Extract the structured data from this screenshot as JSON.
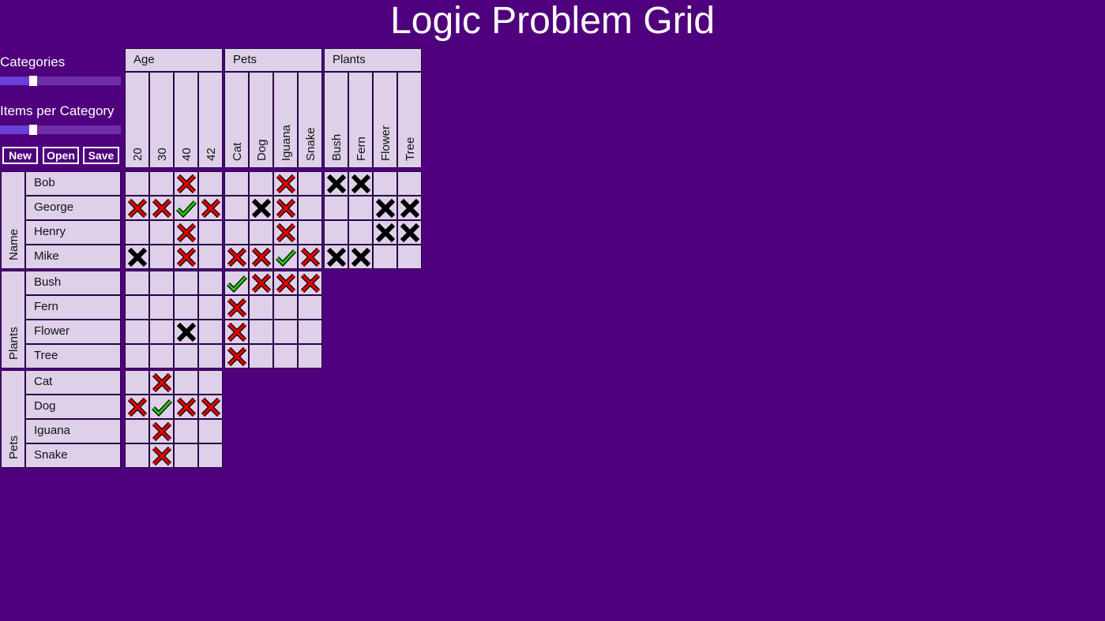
{
  "app": {
    "title": "Logic Problem Grid"
  },
  "controls": {
    "categories_label": "Categories",
    "items_label": "Items per Category",
    "categories_value": 0.27,
    "items_value": 0.27,
    "buttons": {
      "new": "New",
      "open": "Open",
      "save": "Save"
    }
  },
  "colors": {
    "background": "#4f007c",
    "cell": "#ddd0e8",
    "red_x": "#e00000",
    "black_x": "#000000",
    "green_check": "#22cc00"
  },
  "columns": [
    {
      "name": "Age",
      "items": [
        "20",
        "30",
        "40",
        "42"
      ]
    },
    {
      "name": "Pets",
      "items": [
        "Cat",
        "Dog",
        "Iguana",
        "Snake"
      ]
    },
    {
      "name": "Plants",
      "items": [
        "Bush",
        "Fern",
        "Flower",
        "Tree"
      ]
    }
  ],
  "rows": [
    {
      "name": "Name",
      "items": [
        "Bob",
        "George",
        "Henry",
        "Mike"
      ]
    },
    {
      "name": "Plants",
      "items": [
        "Bush",
        "Fern",
        "Flower",
        "Tree"
      ]
    },
    {
      "name": "Pets",
      "items": [
        "Cat",
        "Dog",
        "Iguana",
        "Snake"
      ]
    }
  ],
  "marks": {
    "legend": "x = red cross, X = black cross, v = green check, . = empty",
    "Name|Age": [
      "..x.",
      "xxvx",
      "..x.",
      "X.x."
    ],
    "Name|Pets": [
      "..x.",
      ".Xx.",
      "..x.",
      "xxvx"
    ],
    "Name|Plants": [
      "XX..",
      "..XX",
      "..XX",
      "XX.."
    ],
    "Plants|Age": [
      "....",
      "....",
      "..X.",
      "...."
    ],
    "Plants|Pets": [
      "vxxx",
      "x...",
      "x...",
      "x..."
    ],
    "Pets|Age": [
      ".x..",
      "xvxx",
      ".x..",
      ".x.."
    ]
  }
}
